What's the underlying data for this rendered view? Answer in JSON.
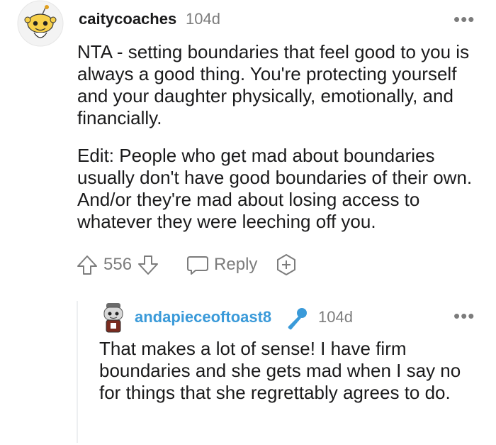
{
  "comment": {
    "username": "caitycoaches",
    "age": "104d",
    "more_label": "•••",
    "paragraphs": [
      "NTA - setting boundaries that feel good to you is always a good thing. You're protecting yourself and your daughter physically, emotionally, and financially.",
      "Edit: People who get mad about boundaries usually don't have good boundaries of their own. And/or they're mad about losing access to whatever they were leeching off you."
    ],
    "actions": {
      "vote_count": "556",
      "reply_label": "Reply"
    }
  },
  "reply": {
    "username": "andapieceoftoast8",
    "age": "104d",
    "more_label": "•••",
    "text": "That makes a lot of sense! I have firm boundaries and she gets mad when I say no for things that she regrettably agrees to do."
  },
  "colors": {
    "text": "#1a1a1b",
    "meta": "#7c7c7c",
    "reply_username": "#3a9ad9",
    "thread_line": "#edeff1"
  },
  "icons": {
    "avatar_top": "snoo-avatar-icon",
    "upvote": "upvote-arrow-icon",
    "downvote": "downvote-arrow-icon",
    "reply": "speech-bubble-icon",
    "award": "award-plus-icon",
    "mic": "microphone-icon",
    "avatar_reply": "toast-avatar-icon"
  }
}
